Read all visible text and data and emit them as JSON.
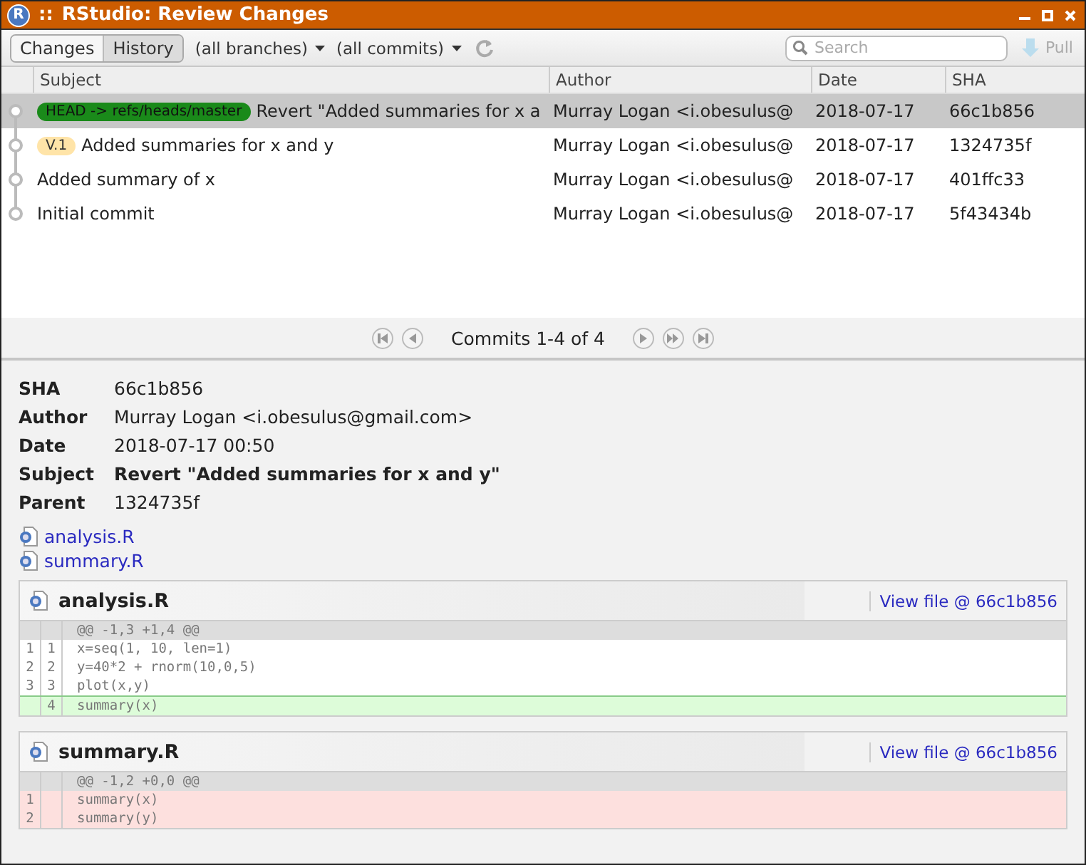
{
  "window": {
    "title": "RStudio: Review Changes",
    "logo": "R",
    "menu_glyph": "::"
  },
  "toolbar": {
    "tabs": [
      {
        "label": "Changes",
        "selected": false
      },
      {
        "label": "History",
        "selected": true
      }
    ],
    "branch_filter": "(all branches)",
    "commit_filter": "(all commits)",
    "search": {
      "placeholder": "Search"
    },
    "pull": {
      "label": "Pull",
      "disabled": true
    }
  },
  "commits": {
    "columns": [
      "Subject",
      "Author",
      "Date",
      "SHA"
    ],
    "rows": [
      {
        "refs": [
          {
            "label": "HEAD -> refs/heads/master",
            "color": "#1a8a1a"
          }
        ],
        "subject": "Revert \"Added summaries for x a",
        "author": "Murray Logan <i.obesulus@",
        "date": "2018-07-17",
        "sha": "66c1b856",
        "selected": true
      },
      {
        "refs": [
          {
            "label": "V.1",
            "color": "#ffe4a8"
          }
        ],
        "subject": "Added summaries for x and y",
        "author": "Murray Logan <i.obesulus@",
        "date": "2018-07-17",
        "sha": "1324735f",
        "selected": false
      },
      {
        "refs": [],
        "subject": "Added summary of x",
        "author": "Murray Logan <i.obesulus@",
        "date": "2018-07-17",
        "sha": "401ffc33",
        "selected": false
      },
      {
        "refs": [],
        "subject": "Initial commit",
        "author": "Murray Logan <i.obesulus@",
        "date": "2018-07-17",
        "sha": "5f43434b",
        "selected": false
      }
    ]
  },
  "pager": {
    "label": "Commits 1-4 of 4"
  },
  "details": {
    "fields": [
      {
        "label": "SHA",
        "value": "66c1b856"
      },
      {
        "label": "Author",
        "value": "Murray Logan <i.obesulus@gmail.com>"
      },
      {
        "label": "Date",
        "value": "2018-07-17 00:50"
      },
      {
        "label": "Subject",
        "value": "Revert \"Added summaries for x and y\"",
        "bold": true
      },
      {
        "label": "Parent",
        "value": "1324735f"
      }
    ],
    "files": [
      "analysis.R",
      "summary.R"
    ],
    "diffs": [
      {
        "file": "analysis.R",
        "view_link": "View file @ 66c1b856",
        "hunk": "@@ -1,3 +1,4 @@",
        "lines": [
          {
            "kind": "context",
            "old": "1",
            "new": "1",
            "code": "x=seq(1, 10, len=1)"
          },
          {
            "kind": "context",
            "old": "2",
            "new": "2",
            "code": "y=40*2 + rnorm(10,0,5)"
          },
          {
            "kind": "context",
            "old": "3",
            "new": "3",
            "code": "plot(x,y)"
          },
          {
            "kind": "added",
            "new": "4",
            "code": "summary(x)"
          }
        ]
      },
      {
        "file": "summary.R",
        "view_link": "View file @ 66c1b856",
        "hunk": "@@ -1,2 +0,0 @@",
        "lines": [
          {
            "kind": "removed",
            "old": "1",
            "code": "summary(x)"
          },
          {
            "kind": "removed",
            "old": "2",
            "code": "summary(y)"
          }
        ]
      }
    ]
  }
}
